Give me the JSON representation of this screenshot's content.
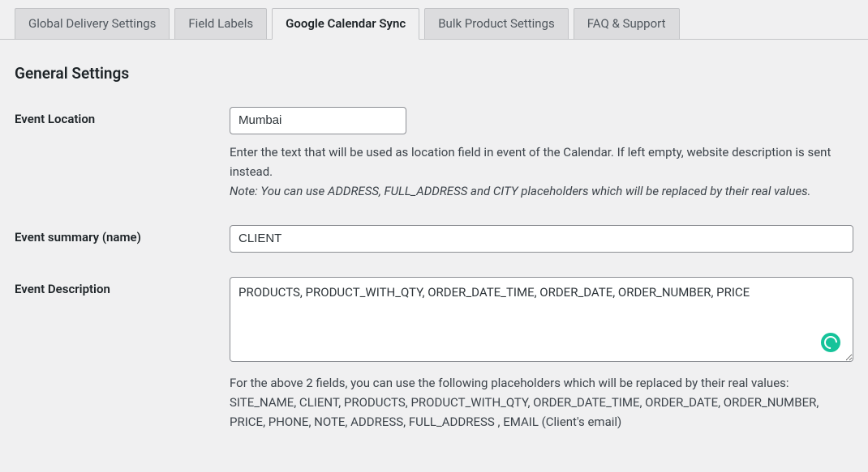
{
  "tabs": [
    {
      "label": "Global Delivery Settings",
      "active": false
    },
    {
      "label": "Field Labels",
      "active": false
    },
    {
      "label": "Google Calendar Sync",
      "active": true
    },
    {
      "label": "Bulk Product Settings",
      "active": false
    },
    {
      "label": "FAQ & Support",
      "active": false
    }
  ],
  "section_title": "General Settings",
  "event_location": {
    "label": "Event Location",
    "value": "Mumbai",
    "help": "Enter the text that will be used as location field in event of the Calendar. If left empty, website description is sent instead.",
    "note": "Note: You can use ADDRESS, FULL_ADDRESS and CITY placeholders which will be replaced by their real values."
  },
  "event_summary": {
    "label": "Event summary (name)",
    "value": "CLIENT"
  },
  "event_description": {
    "label": "Event Description",
    "value": "PRODUCTS, PRODUCT_WITH_QTY, ORDER_DATE_TIME, ORDER_DATE, ORDER_NUMBER, PRICE",
    "help": "For the above 2 fields, you can use the following placeholders which will be replaced by their real values: SITE_NAME, CLIENT, PRODUCTS, PRODUCT_WITH_QTY, ORDER_DATE_TIME, ORDER_DATE, ORDER_NUMBER, PRICE, PHONE, NOTE, ADDRESS, FULL_ADDRESS , EMAIL (Client's email)"
  }
}
